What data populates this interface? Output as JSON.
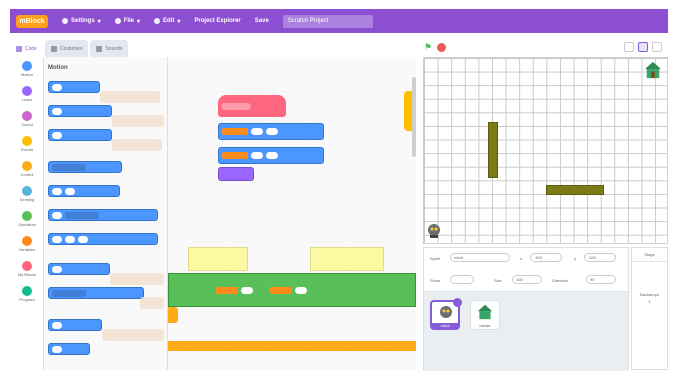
{
  "menubar": {
    "logo": "mBlock",
    "items": [
      {
        "label": "Settings"
      },
      {
        "label": "File"
      },
      {
        "label": "Edit"
      },
      {
        "label": "Project Explorer"
      },
      {
        "label": "Save"
      }
    ],
    "project_name": "Scratch Project"
  },
  "tabs": [
    {
      "label": "Code",
      "icon": "code-icon",
      "active": true
    },
    {
      "label": "Costumes",
      "icon": "brush-icon",
      "active": false
    },
    {
      "label": "Sounds",
      "icon": "speaker-icon",
      "active": false
    }
  ],
  "categories": [
    {
      "label": "Motion",
      "color": "#4c97ff"
    },
    {
      "label": "Looks",
      "color": "#9966ff"
    },
    {
      "label": "Sound",
      "color": "#cf63cf"
    },
    {
      "label": "Events",
      "color": "#ffbf00"
    },
    {
      "label": "Control",
      "color": "#ffab19"
    },
    {
      "label": "Sensing",
      "color": "#5cb1d6"
    },
    {
      "label": "Operators",
      "color": "#59c059"
    },
    {
      "label": "Variables",
      "color": "#ff8c1a"
    },
    {
      "label": "My Blocks",
      "color": "#ff6680"
    },
    {
      "label": "Program",
      "color": "#0fbd8c"
    }
  ],
  "palette": {
    "title": "Motion"
  },
  "stage": {
    "flag_icon": "green-flag-icon",
    "stop_icon": "stop-icon"
  },
  "sprite_info": {
    "sprite_label": "Sprite",
    "sprite_name": "robot",
    "x_label": "x",
    "x_value": "-100",
    "y_label": "y",
    "y_value": "-100",
    "show_label": "Show",
    "size_label": "Size",
    "size_value": "100",
    "direction_label": "Direction",
    "direction_value": "90"
  },
  "sprites": [
    {
      "name": "robot",
      "selected": true
    },
    {
      "name": "house",
      "selected": false
    }
  ],
  "stage_pane": {
    "header": "Stage",
    "backdrops_label": "Backdrops",
    "backdrops_count": "1"
  },
  "colors": {
    "accent": "#8c4fd1",
    "motion": "#4c97ff",
    "events": "#ffbf00",
    "operators": "#59c059",
    "my_blocks": "#ff6680",
    "wall": "#7b7a14"
  }
}
